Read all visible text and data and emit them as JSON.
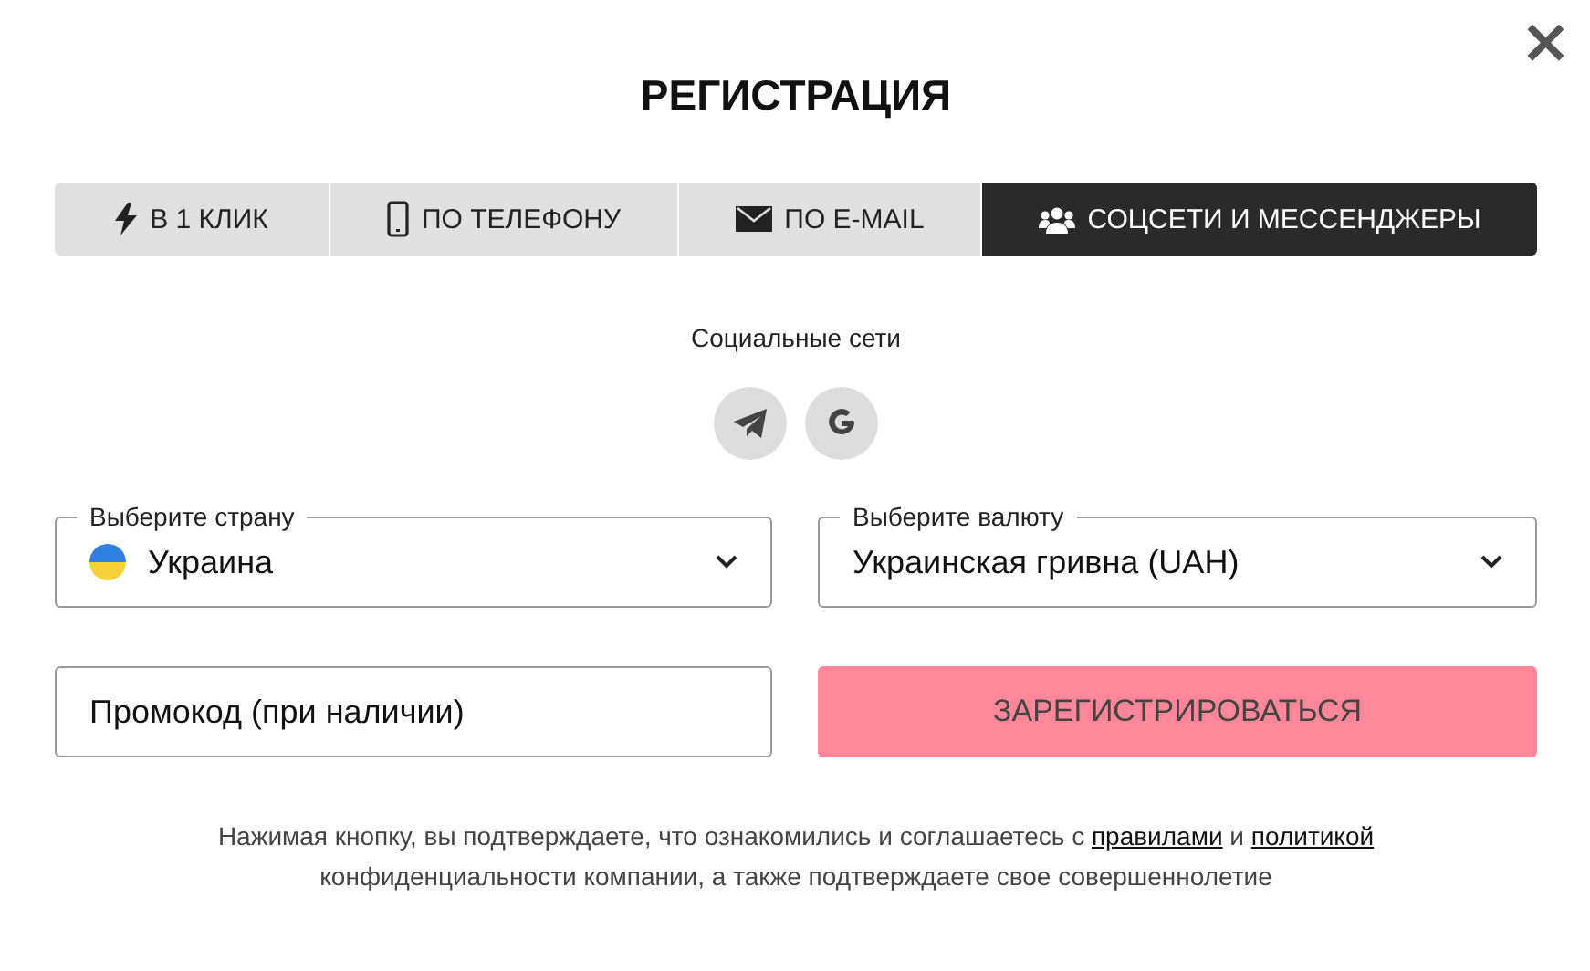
{
  "title": "РЕГИСТРАЦИЯ",
  "close": "×",
  "tabs": [
    {
      "kind": "bolt",
      "label": "В 1 КЛИК",
      "selected": false
    },
    {
      "kind": "phone",
      "label": "ПО ТЕЛЕФОНУ",
      "selected": false
    },
    {
      "kind": "mail",
      "label": "ПО E-MAIL",
      "selected": false
    },
    {
      "kind": "people",
      "label": "СОЦСЕТИ И МЕССЕНДЖЕРЫ",
      "selected": true
    }
  ],
  "social": {
    "label": "Социальные сети",
    "buttons": [
      {
        "kind": "telegram"
      },
      {
        "kind": "google"
      }
    ]
  },
  "country": {
    "label": "Выберите страну",
    "value": "Украина"
  },
  "currency": {
    "label": "Выберите валюту",
    "value": "Украинская гривна (UAH)"
  },
  "promo": {
    "placeholder": "Промокод (при наличии)"
  },
  "submit": {
    "label": "ЗАРЕГИСТРИРОВАТЬСЯ",
    "disabled": true
  },
  "legal": {
    "before": "Нажимая кнопку, вы подтверждаете, что ознакомились и соглашаетесь с",
    "link1": "правилами",
    "middle": "и",
    "link2": "политикой",
    "after": "конфиденциальности компании, а также подтверждаете свое совершеннолетие"
  }
}
